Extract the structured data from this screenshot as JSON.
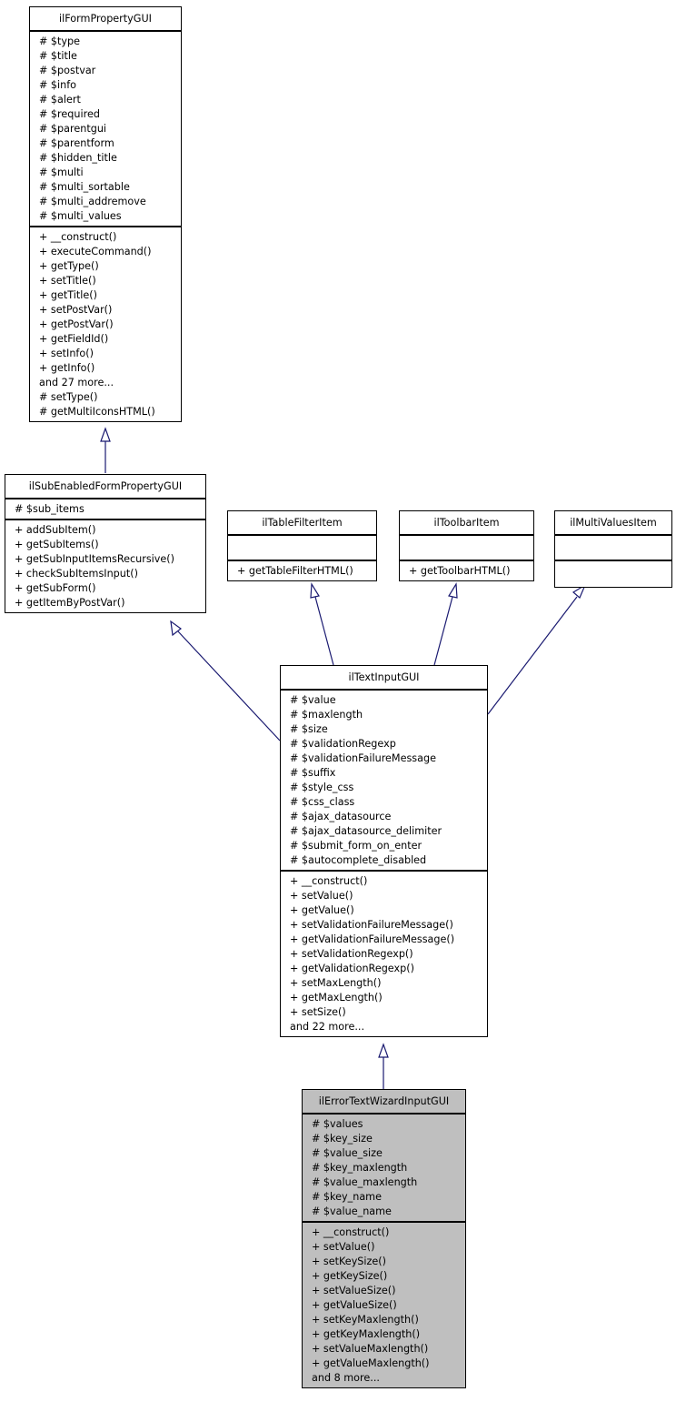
{
  "diagram": {
    "type": "inheritance-class-diagram",
    "classes": {
      "ilFormPropertyGUI": {
        "name": "ilFormPropertyGUI",
        "attributes": [
          "# $type",
          "# $title",
          "# $postvar",
          "# $info",
          "# $alert",
          "# $required",
          "# $parentgui",
          "# $parentform",
          "# $hidden_title",
          "# $multi",
          "# $multi_sortable",
          "# $multi_addremove",
          "# $multi_values"
        ],
        "methods": [
          "+ __construct()",
          "+ executeCommand()",
          "+ getType()",
          "+ setTitle()",
          "+ getTitle()",
          "+ setPostVar()",
          "+ getPostVar()",
          "+ getFieldId()",
          "+ setInfo()",
          "+ getInfo()",
          "and 27 more...",
          "# setType()",
          "# getMultiIconsHTML()"
        ]
      },
      "ilSubEnabledFormPropertyGUI": {
        "name": "ilSubEnabledFormPropertyGUI",
        "attributes": [
          "# $sub_items"
        ],
        "methods": [
          "+ addSubItem()",
          "+ getSubItems()",
          "+ getSubInputItemsRecursive()",
          "+ checkSubItemsInput()",
          "+ getSubForm()",
          "+ getItemByPostVar()"
        ]
      },
      "ilTableFilterItem": {
        "name": "ilTableFilterItem",
        "attributes": [],
        "methods": [
          "+ getTableFilterHTML()"
        ]
      },
      "ilToolbarItem": {
        "name": "ilToolbarItem",
        "attributes": [],
        "methods": [
          "+ getToolbarHTML()"
        ]
      },
      "ilMultiValuesItem": {
        "name": "ilMultiValuesItem",
        "attributes": [],
        "methods": []
      },
      "ilTextInputGUI": {
        "name": "ilTextInputGUI",
        "attributes": [
          "# $value",
          "# $maxlength",
          "# $size",
          "# $validationRegexp",
          "# $validationFailureMessage",
          "# $suffix",
          "# $style_css",
          "# $css_class",
          "# $ajax_datasource",
          "# $ajax_datasource_delimiter",
          "# $submit_form_on_enter",
          "# $autocomplete_disabled"
        ],
        "methods": [
          "+ __construct()",
          "+ setValue()",
          "+ getValue()",
          "+ setValidationFailureMessage()",
          "+ getValidationFailureMessage()",
          "+ setValidationRegexp()",
          "+ getValidationRegexp()",
          "+ setMaxLength()",
          "+ getMaxLength()",
          "+ setSize()",
          "and 22 more..."
        ]
      },
      "ilErrorTextWizardInputGUI": {
        "name": "ilErrorTextWizardInputGUI",
        "attributes": [
          "# $values",
          "# $key_size",
          "# $value_size",
          "# $key_maxlength",
          "# $value_maxlength",
          "# $key_name",
          "# $value_name"
        ],
        "methods": [
          "+ __construct()",
          "+ setValue()",
          "+ setKeySize()",
          "+ getKeySize()",
          "+ setValueSize()",
          "+ getValueSize()",
          "+ setKeyMaxlength()",
          "+ getKeyMaxlength()",
          "+ setValueMaxlength()",
          "+ getValueMaxlength()",
          "and 8 more..."
        ]
      }
    },
    "edges": [
      {
        "from": "ilSubEnabledFormPropertyGUI",
        "to": "ilFormPropertyGUI",
        "kind": "inherits"
      },
      {
        "from": "ilTextInputGUI",
        "to": "ilSubEnabledFormPropertyGUI",
        "kind": "inherits"
      },
      {
        "from": "ilTextInputGUI",
        "to": "ilTableFilterItem",
        "kind": "implements"
      },
      {
        "from": "ilTextInputGUI",
        "to": "ilToolbarItem",
        "kind": "implements"
      },
      {
        "from": "ilTextInputGUI",
        "to": "ilMultiValuesItem",
        "kind": "implements"
      },
      {
        "from": "ilErrorTextWizardInputGUI",
        "to": "ilTextInputGUI",
        "kind": "inherits"
      }
    ],
    "colors": {
      "edge": "#191970",
      "highlight_fill": "#bfbfbf",
      "box_border": "#000000"
    }
  }
}
